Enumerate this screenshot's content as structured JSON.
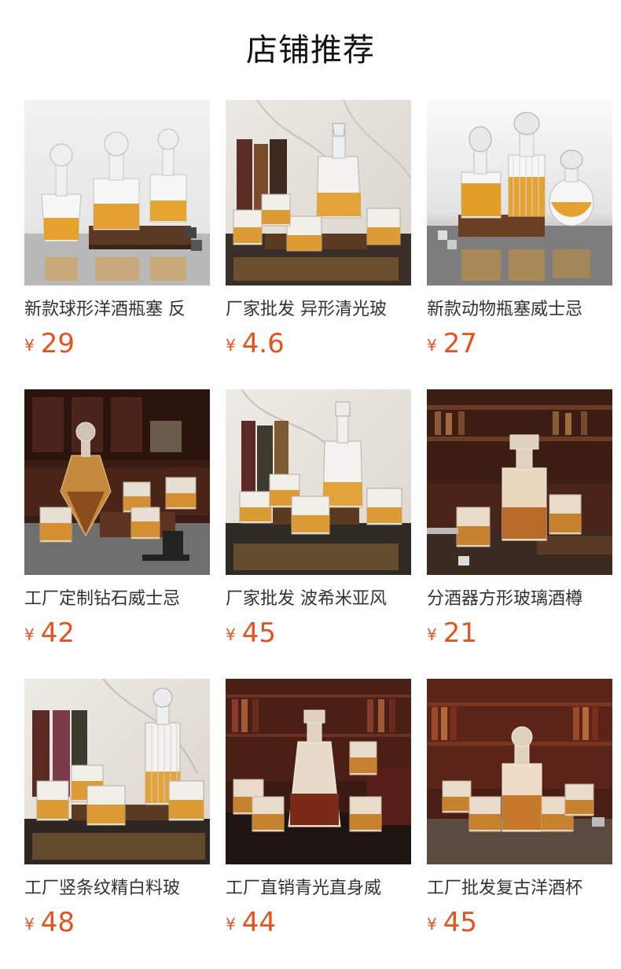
{
  "page_title": "店铺推荐",
  "currency_symbol": "¥",
  "colors": {
    "price": "#e4531f",
    "title_text": "#333333"
  },
  "products": [
    {
      "title": "新款球形洋酒瓶塞 反",
      "price": "29",
      "image": "three globe-stopper decanters on wooden board, light background"
    },
    {
      "title": "厂家批发 异形清光玻",
      "price": "4.6",
      "image": "twisted decanter and glasses on wooden stand, marble background"
    },
    {
      "title": "新款动物瓶塞威士忌",
      "price": "27",
      "image": "three decanters with animal-head stoppers"
    },
    {
      "title": "工厂定制钻石威士忌",
      "price": "42",
      "image": "diamond-shaped decanter with glasses, dark wood room"
    },
    {
      "title": "厂家批发 波希米亚风",
      "price": "45",
      "image": "bohemian-style decanter set on marble background"
    },
    {
      "title": "分酒器方形玻璃酒樽",
      "price": "21",
      "image": "square cut-glass decanter in bar setting"
    },
    {
      "title": "工厂竖条纹精白料玻",
      "price": "48",
      "image": "vertical-stripe decanter with tumblers, marble background"
    },
    {
      "title": "工厂直销青光直身威",
      "price": "44",
      "image": "tall decanter with glasses and wooden box, library background"
    },
    {
      "title": "工厂批发复古洋酒杯",
      "price": "45",
      "image": "vintage cut-glass decanter set, bookshelf background"
    }
  ]
}
